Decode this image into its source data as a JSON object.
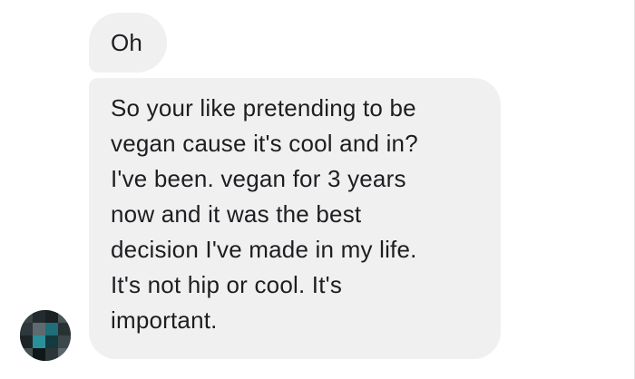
{
  "conversation": {
    "messages": [
      {
        "text": "Oh"
      },
      {
        "lines": [
          "So your like pretending to be",
          "vegan cause it's cool and in?",
          "I've been. vegan for 3 years",
          "now and it was the best",
          "decision I've made in my life.",
          "It's not hip or cool. It's",
          "important."
        ]
      }
    ]
  },
  "sender": {
    "avatar": "pixelated-avatar"
  },
  "colors": {
    "bubble_background": "#f1f0f0",
    "text": "#1c1e21",
    "page_background": "#ffffff"
  }
}
